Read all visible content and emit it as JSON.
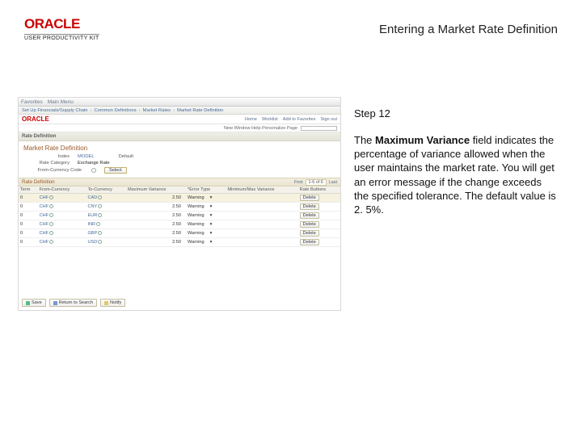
{
  "logo": {
    "brand": "ORACLE",
    "sub": "USER PRODUCTIVITY KIT"
  },
  "page_title": "Entering a Market Rate Definition",
  "step": {
    "label": "Step 12"
  },
  "instruction": {
    "pre": "The ",
    "bold": "Maximum Variance",
    "post": " field indicates the percentage of variance allowed when the user maintains the market rate. You will get an error message if the change exceeds the specified tolerance. The default value is 2. 5%."
  },
  "app": {
    "topbar": {
      "item1": "Favorites",
      "item2": "Main Menu"
    },
    "breadcrumb": {
      "c1": "Set Up Financials/Supply Chain",
      "s": "›",
      "c2": "Common Definitions",
      "c3": "Market Rates",
      "c4": "Market Rate Definition"
    },
    "brand": "ORACLE",
    "links": {
      "l1": "Home",
      "l2": "Worklist",
      "l3": "Add to Favorites",
      "l4": "Sign out"
    },
    "row3": {
      "lbl": "New Window  Help  Personalize Page"
    },
    "section": "Rate Definition",
    "formtitle": "Market Rate Definition",
    "form": {
      "index_lbl": "Index",
      "index_val": "MODEL",
      "default_lbl": "Default",
      "type_lbl": "Rate Category",
      "type_val": "Exchange Rate",
      "fromcode_lbl": "From-Currency Code",
      "fromcode_btn": "Select"
    },
    "rates": {
      "title": "Rate Definition",
      "first": "First",
      "nums": "1-6 of 6",
      "last": "Last",
      "cols": {
        "term": "Term",
        "from": "From-Currency",
        "to": "To-Currency",
        "maxvar": "Maximum Variance",
        "errtype": "*Error Type",
        "minvar": "Minimum/Max Variance",
        "btns": "Rate Buttons"
      },
      "rows": [
        {
          "term": "0",
          "from": "CHF",
          "to": "CAD",
          "mv": "2.50",
          "err": "Warning",
          "btn": "Delete"
        },
        {
          "term": "0",
          "from": "CHF",
          "to": "CNY",
          "mv": "2.50",
          "err": "Warning",
          "btn": "Delete"
        },
        {
          "term": "0",
          "from": "CHF",
          "to": "EUR",
          "mv": "2.50",
          "err": "Warning",
          "btn": "Delete"
        },
        {
          "term": "0",
          "from": "CHF",
          "to": "INR",
          "mv": "2.50",
          "err": "Warning",
          "btn": "Delete"
        },
        {
          "term": "0",
          "from": "CHF",
          "to": "GBP",
          "mv": "2.50",
          "err": "Warning",
          "btn": "Delete"
        },
        {
          "term": "0",
          "from": "CHF",
          "to": "USD",
          "mv": "2.50",
          "err": "Warning",
          "btn": "Delete"
        }
      ]
    },
    "footer": {
      "save": "Save",
      "ret": "Return to Search",
      "notify": "Notify"
    }
  }
}
